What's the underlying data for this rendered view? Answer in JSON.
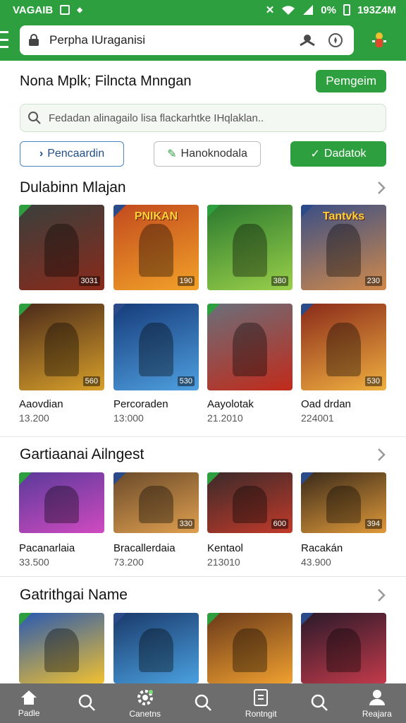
{
  "status": {
    "left_text": "VAGAIB",
    "right_text": "0%",
    "clock": "193Z4M"
  },
  "toolbar": {
    "url_text": "Perpha IUraganisi"
  },
  "header": {
    "title": "Nona Mplk; Filncta Mnngan",
    "action_label": "Pemgeim"
  },
  "search": {
    "placeholder": "Fedadan alinagailo lisa flackarhtke IHqlaklan.."
  },
  "chips": [
    {
      "label": "Pencaardin"
    },
    {
      "label": "Hanoknodala"
    },
    {
      "label": "Dadatok"
    }
  ],
  "sections": [
    {
      "title": "Dulabinn Mlajan",
      "row1": [
        {
          "badge": "3031",
          "banner": "",
          "color_a": "#3a3f3c",
          "color_b": "#8a2a1a"
        },
        {
          "badge": "190",
          "banner": "PNIKAN",
          "color_a": "#c24a1e",
          "color_b": "#f2a229"
        },
        {
          "badge": "380",
          "banner": "",
          "color_a": "#2a7a2f",
          "color_b": "#9ad04a"
        },
        {
          "badge": "230",
          "banner": "Tantvks",
          "color_a": "#3a4f86",
          "color_b": "#d18a4a"
        }
      ],
      "row2": [
        {
          "badge": "560",
          "color_a": "#4a2a1a",
          "color_b": "#d8a02a"
        },
        {
          "badge": "530",
          "color_a": "#163b7a",
          "color_b": "#4fa0e0"
        },
        {
          "badge": "",
          "color_a": "#6a6f7a",
          "color_b": "#c22a1a"
        },
        {
          "badge": "530",
          "color_a": "#8a2a1a",
          "color_b": "#f0b040"
        }
      ],
      "names": [
        {
          "name": "Aaovdian",
          "sub": "13.200"
        },
        {
          "name": "Percoraden",
          "sub": "13:000"
        },
        {
          "name": "Aayolotak",
          "sub": "21.2010"
        },
        {
          "name": "Oad drdan",
          "sub": "224001"
        }
      ]
    },
    {
      "title": "Gartiaanai Ailngest",
      "row": [
        {
          "badge": "",
          "color_a": "#5a3a9a",
          "color_b": "#d04ac0"
        },
        {
          "badge": "330",
          "color_a": "#6a4a2a",
          "color_b": "#e0a050"
        },
        {
          "badge": "600",
          "color_a": "#3a2a2a",
          "color_b": "#c23a2a"
        },
        {
          "badge": "394",
          "color_a": "#3a2a1a",
          "color_b": "#e09a3a"
        }
      ],
      "names": [
        {
          "name": "Pacanarlaia",
          "sub": "33.500"
        },
        {
          "name": "Bracallerdaia",
          "sub": "73.200"
        },
        {
          "name": "Kentaol",
          "sub": "213010"
        },
        {
          "name": "Racakán",
          "sub": "43.900"
        }
      ]
    },
    {
      "title": "Gatrithgai Name",
      "row": [
        {
          "color_a": "#2a5ab0",
          "color_b": "#f0c030"
        },
        {
          "color_a": "#1a3a6a",
          "color_b": "#4aa0e0"
        },
        {
          "color_a": "#6a3a1a",
          "color_b": "#f0a030"
        },
        {
          "color_a": "#2a1a2a",
          "color_b": "#c23a4a"
        }
      ]
    }
  ],
  "nav": [
    {
      "label": "Padle",
      "icon": "home-icon"
    },
    {
      "label": "",
      "icon": "search-icon"
    },
    {
      "label": "Canetns",
      "icon": "settings-icon"
    },
    {
      "label": "",
      "icon": "search-icon"
    },
    {
      "label": "Rontngit",
      "icon": "document-icon"
    },
    {
      "label": "",
      "icon": "search-icon"
    },
    {
      "label": "Reajara",
      "icon": "profile-icon"
    }
  ],
  "colors": {
    "brand_green": "#2e9f3f",
    "chip_blue": "#4a86c5",
    "nav_bg": "#6d6d6d"
  }
}
